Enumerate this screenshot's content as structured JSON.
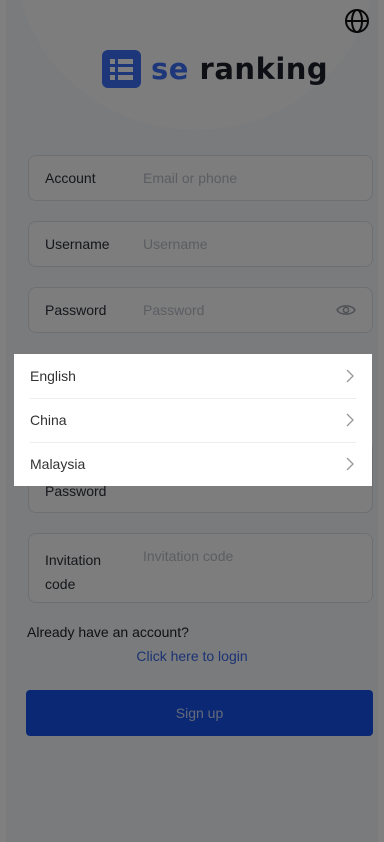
{
  "brand": {
    "prefix": "se",
    "suffix": "ranking"
  },
  "form": {
    "account": {
      "label": "Account",
      "placeholder": "Email or phone"
    },
    "username": {
      "label": "Username",
      "placeholder": "Username"
    },
    "password": {
      "label": "Password",
      "placeholder": "Password"
    },
    "confirm_password": {
      "label": "Password"
    },
    "invitation": {
      "label_line1": "Invitation",
      "label_line2": "code",
      "placeholder": "Invitation code"
    }
  },
  "footer": {
    "have_account": "Already have an account?",
    "login_link": "Click here to login",
    "signup_button": "Sign up"
  },
  "language_menu": {
    "items": [
      {
        "label": "English"
      },
      {
        "label": "China"
      },
      {
        "label": "Malaysia"
      }
    ]
  },
  "colors": {
    "brand_blue": "#3b6ef5",
    "button_blue": "#1551e8",
    "link_blue": "#3566e8"
  },
  "icons": [
    "globe-icon",
    "eye-icon",
    "chevron-right-icon"
  ]
}
